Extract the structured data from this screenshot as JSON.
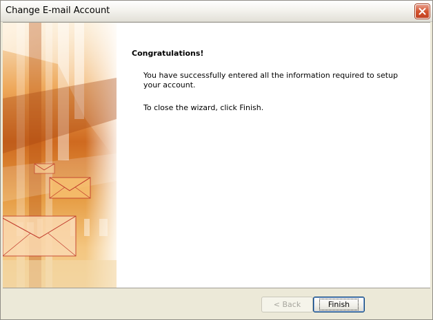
{
  "window": {
    "title": "Change E-mail Account"
  },
  "wizard": {
    "heading": "Congratulations!",
    "message": "You have successfully entered all the information required to setup your account.",
    "instruction": "To close the wizard, click Finish."
  },
  "buttons": {
    "back_label": "< Back",
    "finish_label": "Finish"
  },
  "icons": {
    "close": "close-icon",
    "banner": "envelope-banner-illustration"
  },
  "colors": {
    "close_button": "#d3542f",
    "banner_orange": "#cf6a20",
    "envelope_stroke": "#c0392b"
  }
}
